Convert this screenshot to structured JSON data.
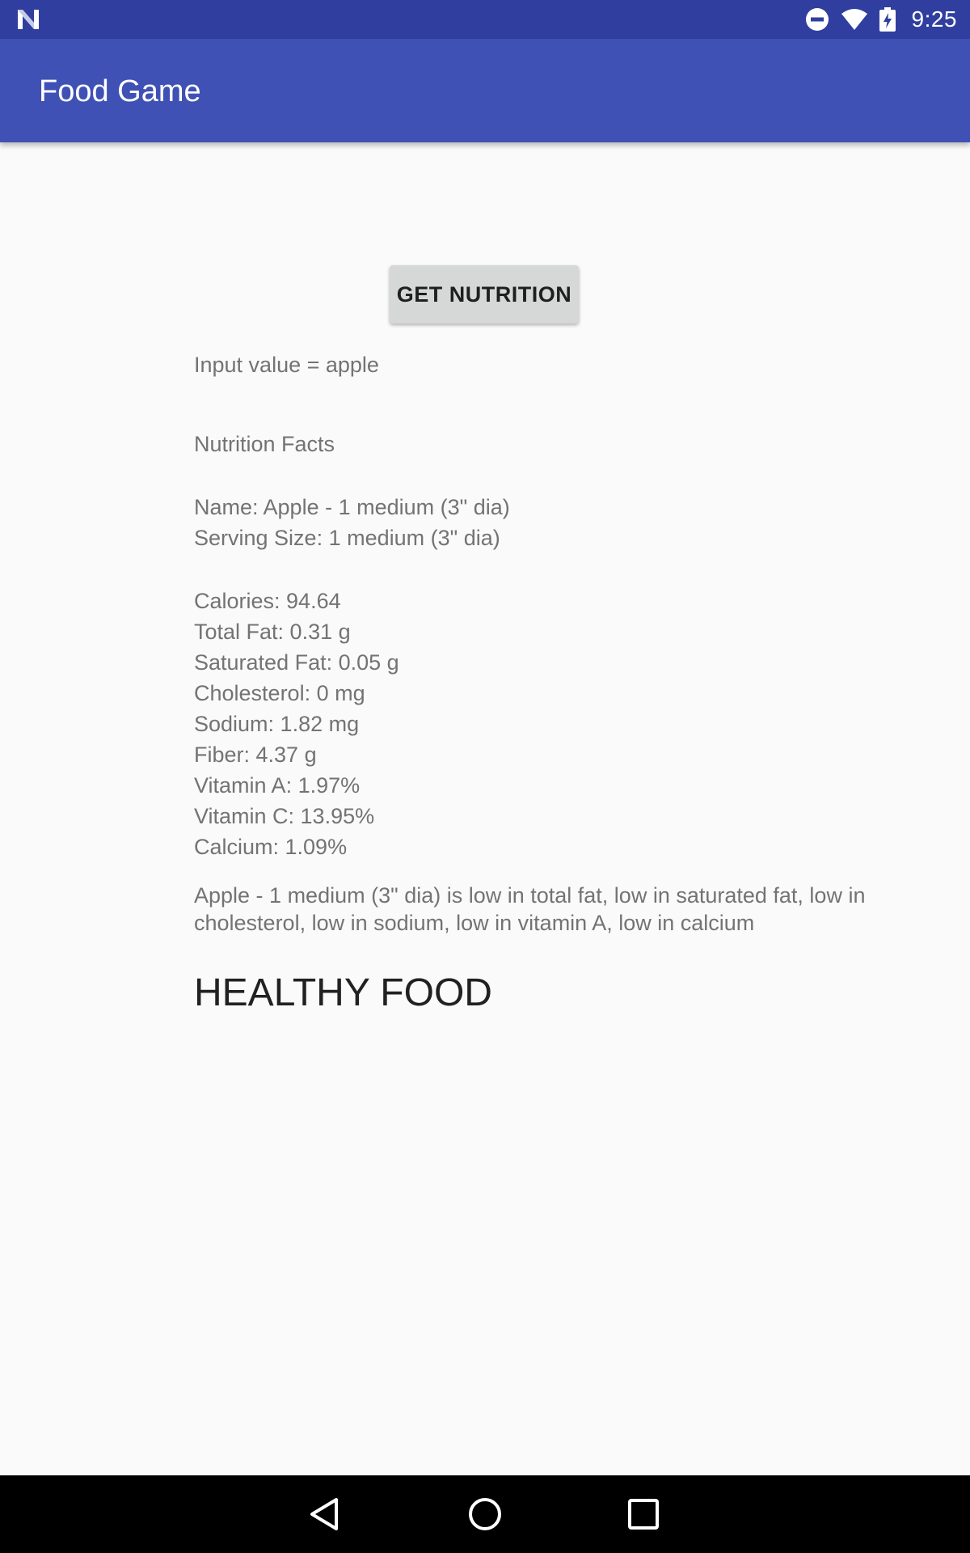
{
  "status_bar": {
    "left_icon": "notification-n-icon",
    "icons": [
      "do-not-disturb-icon",
      "wifi-icon",
      "battery-charging-icon"
    ],
    "time": "9:25"
  },
  "app_bar": {
    "title": "Food Game",
    "color": "#3f51b5"
  },
  "main": {
    "button_label": "GET NUTRITION",
    "input_value_line": "Input value = apple",
    "heading": "Nutrition Facts",
    "name_line": "Name: Apple - 1 medium (3\" dia)",
    "serving_line": "Serving Size: 1 medium (3\" dia)",
    "facts": [
      "Calories: 94.64",
      "Total Fat: 0.31 g",
      "Saturated Fat: 0.05 g",
      "Cholesterol: 0 mg",
      "Sodium: 1.82 mg",
      "Fiber: 4.37 g",
      "Vitamin A: 1.97%",
      "Vitamin C: 13.95%",
      "Calcium: 1.09%"
    ],
    "summary": "Apple - 1 medium (3\" dia) is low in total fat, low in saturated fat, low in cholesterol, low in sodium, low in vitamin A, low in calcium",
    "verdict": "HEALTHY FOOD"
  },
  "nav_bar": {
    "buttons": [
      "back-icon",
      "home-icon",
      "recents-icon"
    ]
  }
}
